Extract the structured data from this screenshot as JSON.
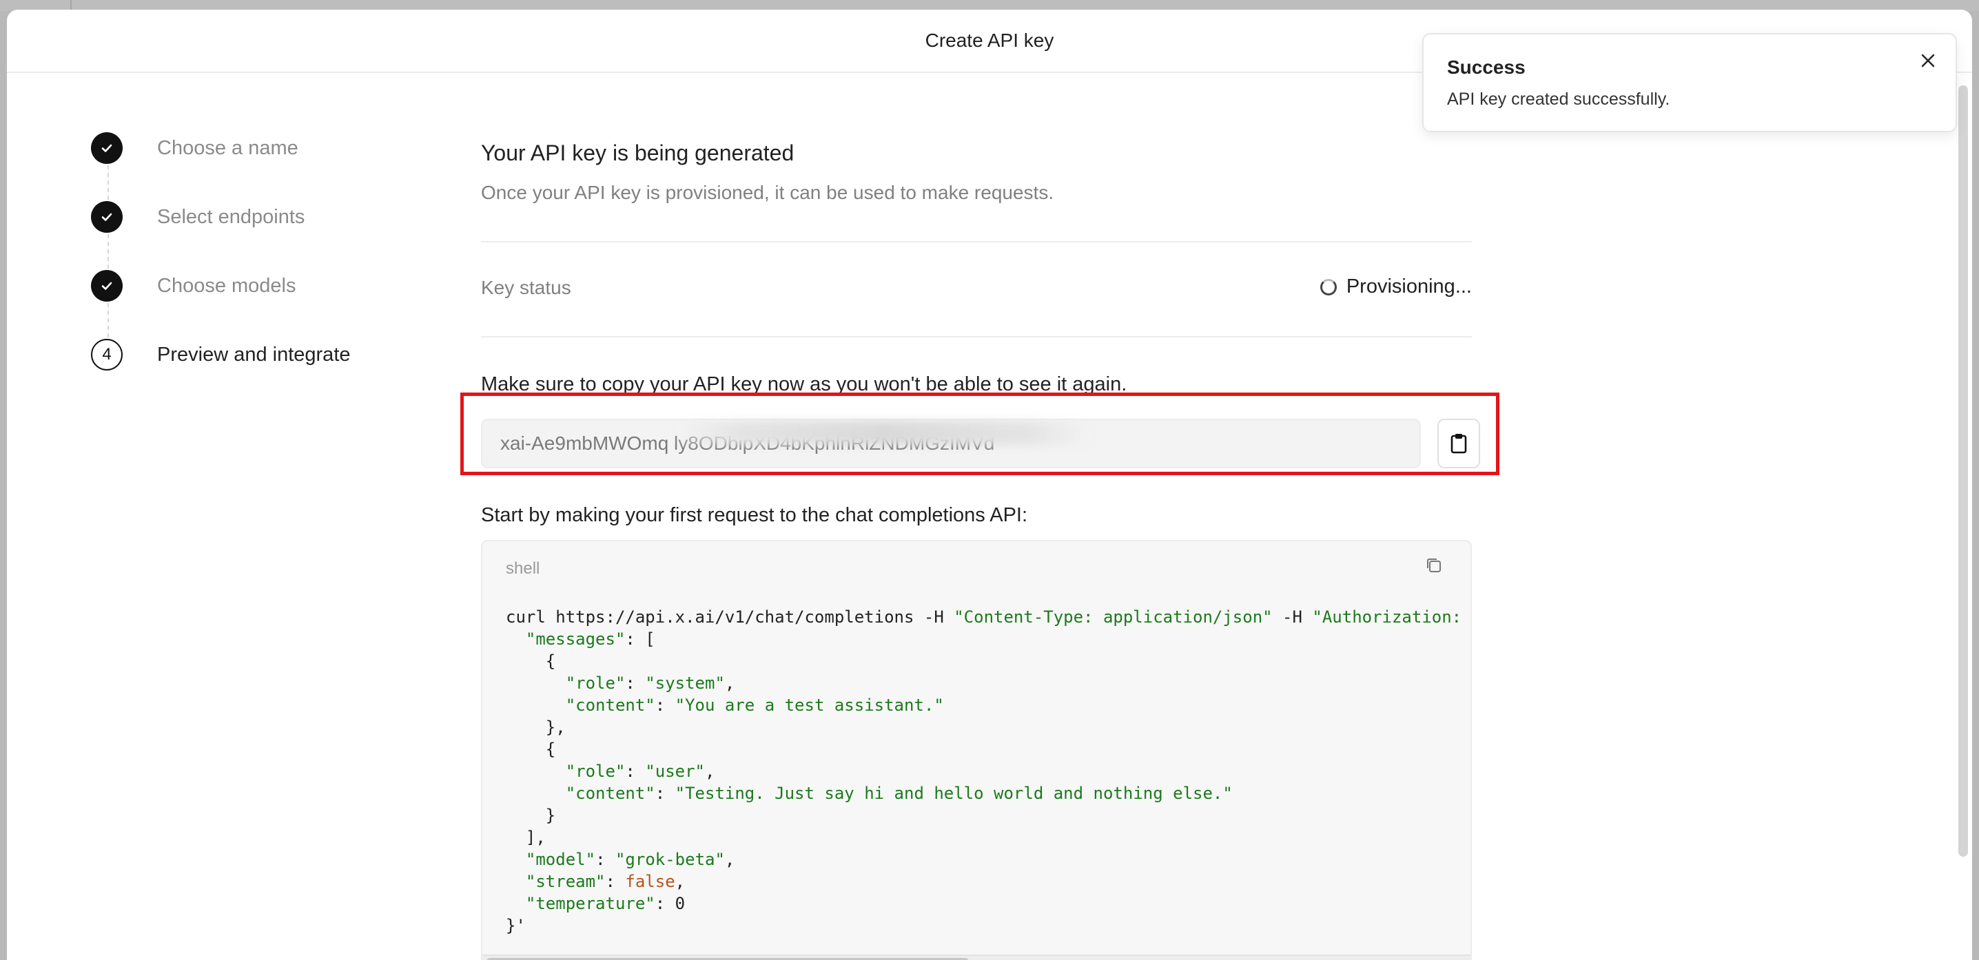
{
  "modal": {
    "title": "Create API key"
  },
  "stepper": {
    "steps": [
      {
        "label": "Choose a name",
        "state": "done"
      },
      {
        "label": "Select endpoints",
        "state": "done"
      },
      {
        "label": "Choose models",
        "state": "done"
      },
      {
        "label": "Preview and integrate",
        "state": "active",
        "number": "4"
      }
    ]
  },
  "main": {
    "title": "Your API key is being generated",
    "subtitle": "Once your API key is provisioned, it can be used to make requests.",
    "status_label": "Key status",
    "status_value": "Provisioning...",
    "copy_note": "Make sure to copy your API key now as you won't be able to see it again.",
    "api_key_value": "xai-Ae9mbMWOmq                                                            ly8ODbipXD4bKphlnRiZNDMGzIMVd",
    "request_note": "Start by making your first request to the chat completions API:",
    "code_lang": "shell"
  },
  "code": {
    "l1_cmd": "curl https://api.x.ai/v1/chat/completions -H ",
    "l1_h1": "\"Content-Type: application/json\"",
    "l1_mid": " -H ",
    "l1_h2": "\"Authorization:",
    "k_messages": "\"messages\"",
    "k_role": "\"role\"",
    "k_content": "\"content\"",
    "v_system": "\"system\"",
    "v_system_content": "\"You are a test assistant.\"",
    "v_user": "\"user\"",
    "v_user_content": "\"Testing. Just say hi and hello world and nothing else.\"",
    "k_model": "\"model\"",
    "v_model": "\"grok-beta\"",
    "k_stream": "\"stream\"",
    "v_stream": "false",
    "k_temperature": "\"temperature\"",
    "v_temperature": "0"
  },
  "toast": {
    "title": "Success",
    "message": "API key created successfully."
  },
  "icons": {
    "step_done": "check-icon",
    "copy_key": "clipboard-icon",
    "copy_code": "copy-icon",
    "close": "close-icon",
    "status": "spinner-icon"
  }
}
